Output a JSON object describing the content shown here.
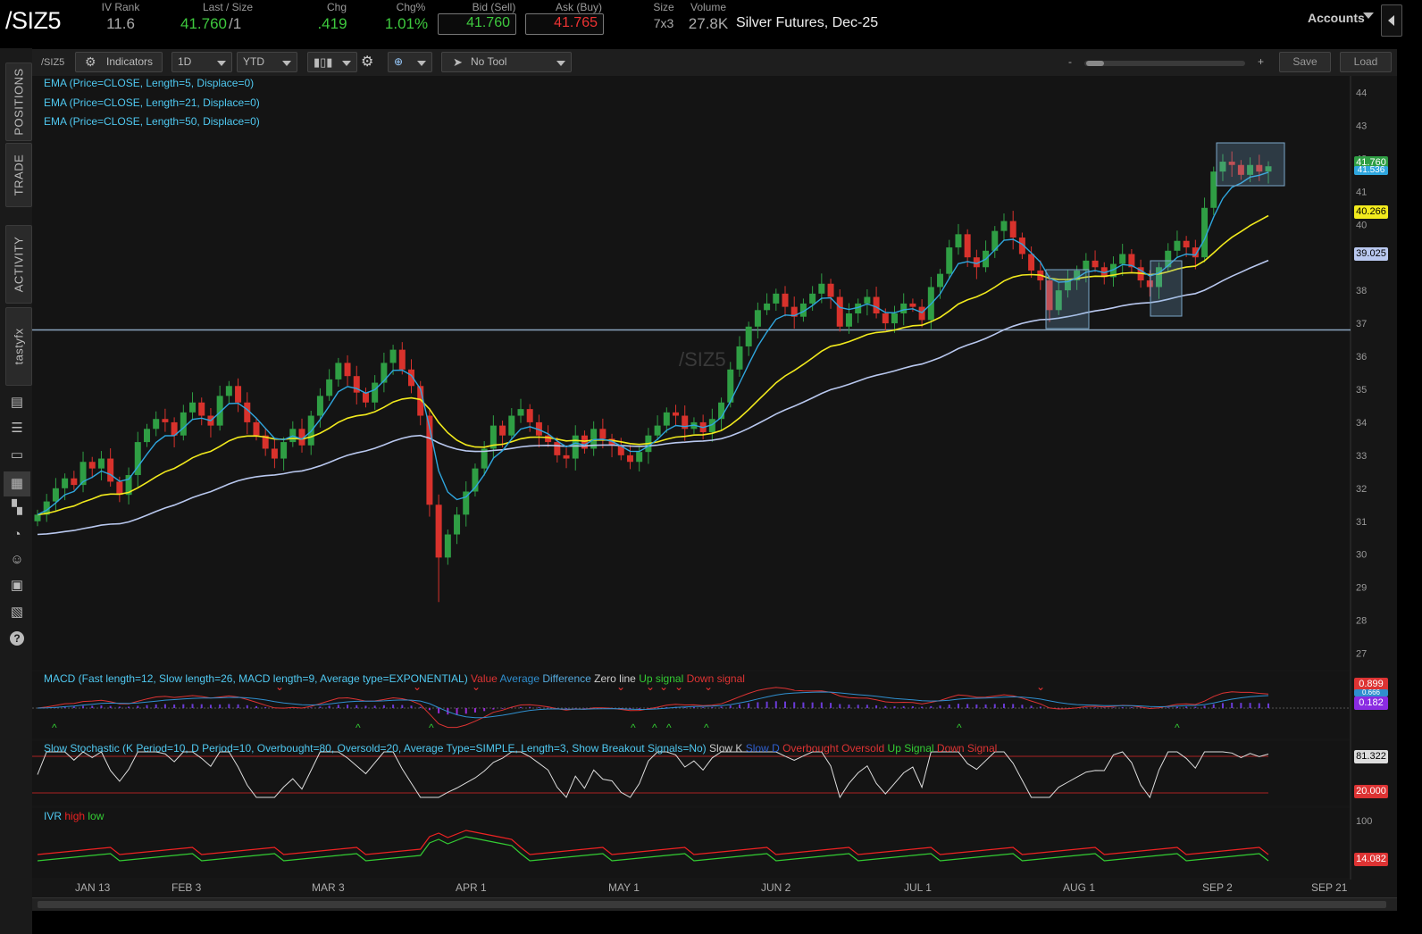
{
  "header": {
    "symbol": "/SIZ5",
    "iv_rank_label": "IV Rank",
    "iv_rank": "11.6",
    "last_label": "Last / Size",
    "last": "41.760",
    "last_size": "/1",
    "chg_label": "Chg",
    "chg": ".419",
    "chgpct_label": "Chg%",
    "chgpct": "1.01%",
    "bid_label": "Bid (Sell)",
    "bid": "41.760",
    "ask_label": "Ask (Buy)",
    "ask": "41.765",
    "size_label": "Size",
    "size": "7x3",
    "volume_label": "Volume",
    "volume": "27.8K",
    "description": "Silver Futures, Dec-25",
    "accounts_label": "Accounts"
  },
  "sidebar": {
    "tabs": [
      "POSITIONS",
      "TRADE",
      "ACTIVITY",
      "tastyfx"
    ],
    "icons": [
      "watchlist-icon",
      "list-icon",
      "monitor-icon",
      "chart-icon",
      "grid-icon",
      "gauge-icon",
      "people-icon",
      "calendar-icon",
      "news-icon",
      "help-icon"
    ]
  },
  "toolbar": {
    "symbol": "/SIZ5",
    "indicators_label": "Indicators",
    "interval": "1D",
    "range": "YTD",
    "tool": "No Tool",
    "zoom_minus": "-",
    "zoom_plus": "+",
    "save_label": "Save",
    "load_label": "Load"
  },
  "studies": {
    "ema5": "EMA (Price=CLOSE, Length=5, Displace=0)",
    "ema21": "EMA (Price=CLOSE, Length=21, Displace=0)",
    "ema50": "EMA (Price=CLOSE, Length=50, Displace=0)",
    "watermark": "/SIZ5",
    "macd_title": "MACD (Fast length=12, Slow length=26, MACD length=9, Average type=EXPONENTIAL)",
    "macd_value": "Value",
    "macd_average": "Average",
    "macd_difference": "Difference",
    "macd_zero": "Zero line",
    "macd_up": "Up signal",
    "macd_down": "Down signal",
    "stoch_title": "Slow Stochastic (K Period=10, D Period=10, Overbought=80, Oversold=20, Average Type=SIMPLE, Length=3, Show Breakout Signals=No)",
    "stoch_k": "Slow K",
    "stoch_d": "Slow D",
    "stoch_ob": "Overbought",
    "stoch_os": "Oversold",
    "stoch_up": "Up Signal",
    "stoch_down": "Down Signal",
    "ivr_title": "IVR",
    "ivr_high": "high",
    "ivr_low": "low"
  },
  "price_labels": {
    "last": "41.760",
    "ema5": "41.536",
    "ema21": "40.266",
    "ema50": "39.025",
    "macd_value": "0.899",
    "macd_diff": "0.182",
    "macd_avg": "0.666",
    "stoch": "81.322",
    "stoch_os": "20.000",
    "ivr": "14.082"
  },
  "colors": {
    "up": "#2f9e44",
    "down": "#d8322c",
    "ema5": "#2fa6de",
    "ema21": "#f2ea1d",
    "ema50": "#b9c8ef",
    "study_text": "#4fc8f0"
  },
  "axes": {
    "price_ticks": [
      "44",
      "43",
      "42",
      "41",
      "40",
      "39",
      "38",
      "37",
      "36",
      "35",
      "34",
      "33",
      "32",
      "31",
      "30",
      "29",
      "28",
      "27"
    ],
    "macd_ticks": [],
    "ivr_ticks": [
      "100"
    ],
    "dates": [
      "JAN 13",
      "FEB 3",
      "MAR 3",
      "APR 1",
      "MAY 1",
      "JUN 2",
      "JUL 1",
      "AUG 1",
      "SEP 2",
      "SEP 21"
    ]
  },
  "chart_data": {
    "type": "candlestick",
    "title": "/SIZ5",
    "price_range": [
      26.5,
      44.5
    ],
    "closes_approx": [
      31.2,
      31.6,
      32.0,
      32.3,
      32.1,
      32.8,
      32.6,
      32.9,
      32.2,
      31.8,
      32.4,
      33.4,
      33.8,
      34.1,
      34.0,
      33.6,
      34.3,
      34.6,
      34.2,
      33.9,
      34.8,
      35.1,
      34.6,
      34.0,
      33.6,
      33.2,
      32.9,
      33.4,
      33.8,
      33.3,
      34.2,
      34.8,
      35.3,
      35.8,
      35.4,
      34.9,
      34.6,
      35.2,
      35.8,
      36.2,
      35.6,
      35.1,
      34.2,
      31.5,
      29.9,
      30.6,
      31.2,
      31.9,
      32.6,
      33.2,
      33.9,
      33.6,
      34.2,
      34.4,
      34.0,
      33.6,
      33.4,
      33.0,
      32.9,
      33.6,
      33.2,
      33.8,
      33.5,
      33.3,
      33.0,
      32.8,
      33.1,
      33.6,
      33.9,
      34.3,
      34.2,
      33.8,
      34.0,
      33.7,
      34.1,
      34.6,
      35.6,
      36.3,
      36.9,
      37.4,
      37.6,
      37.9,
      37.5,
      37.2,
      37.6,
      37.9,
      38.2,
      37.8,
      36.9,
      37.3,
      37.6,
      37.8,
      37.3,
      37.0,
      37.3,
      37.6,
      37.5,
      37.1,
      38.1,
      38.5,
      39.3,
      39.7,
      39.0,
      38.7,
      39.2,
      39.8,
      40.1,
      39.6,
      39.1,
      38.6,
      38.3,
      37.4,
      38.0,
      38.3,
      38.6,
      38.9,
      38.7,
      38.4,
      38.8,
      39.1,
      38.7,
      38.3,
      38.1,
      38.7,
      39.2,
      39.5,
      39.3,
      39.0,
      40.5,
      41.6,
      41.9,
      41.8,
      41.5,
      41.8,
      41.6,
      41.76
    ],
    "ema21_end": 40.266,
    "ema50_end": 39.025,
    "horizontal_line": 36.8,
    "x_labels": [
      "JAN 13",
      "FEB 3",
      "MAR 3",
      "APR 1",
      "MAY 1",
      "JUN 2",
      "JUL 1",
      "AUG 1",
      "SEP 2",
      "SEP 21"
    ]
  }
}
